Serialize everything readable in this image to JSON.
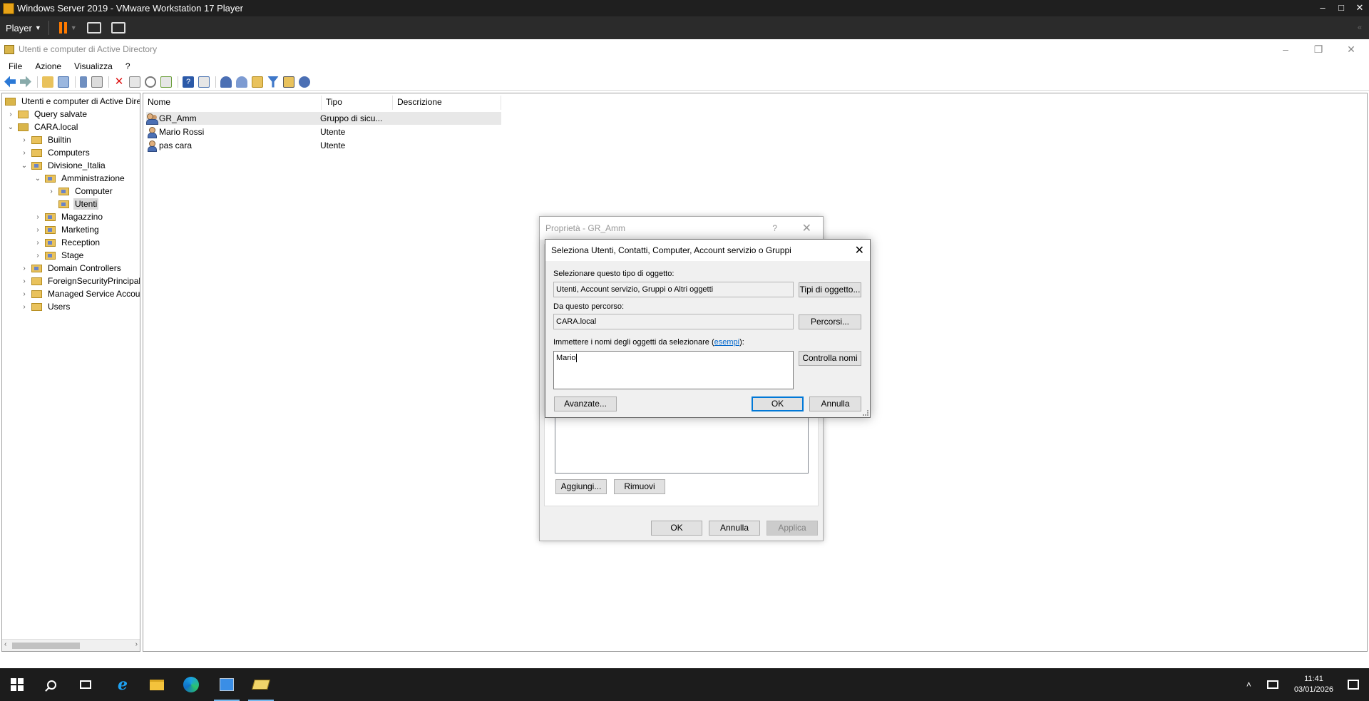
{
  "vmware": {
    "title": "Windows Server 2019 - VMware Workstation 17 Player",
    "player_menu": "Player",
    "window_buttons": {
      "minimize": "–",
      "maximize": "□",
      "close": "✕"
    },
    "collapse_glyph": "«"
  },
  "mmc": {
    "title": "Utenti e computer di Active Directory",
    "menu": [
      "File",
      "Azione",
      "Visualizza",
      "?"
    ],
    "window_buttons": {
      "minimize": "–",
      "restore": "❐",
      "close": "✕"
    }
  },
  "tree": [
    {
      "label": "Utenti e computer di Active Dire",
      "level": 0,
      "expander": "",
      "type": "root"
    },
    {
      "label": "Query salvate",
      "level": 1,
      "expander": ">",
      "type": "folder"
    },
    {
      "label": "CARA.local",
      "level": 1,
      "expander": "v",
      "type": "domain"
    },
    {
      "label": "Builtin",
      "level": 2,
      "expander": ">",
      "type": "folder"
    },
    {
      "label": "Computers",
      "level": 2,
      "expander": ">",
      "type": "folder"
    },
    {
      "label": "Divisione_Italia",
      "level": 2,
      "expander": "v",
      "type": "ou"
    },
    {
      "label": "Amministrazione",
      "level": 3,
      "expander": "v",
      "type": "ou"
    },
    {
      "label": "Computer",
      "level": 4,
      "expander": ">",
      "type": "ou"
    },
    {
      "label": "Utenti",
      "level": 4,
      "expander": "",
      "type": "ou",
      "selected": true
    },
    {
      "label": "Magazzino",
      "level": 3,
      "expander": ">",
      "type": "ou"
    },
    {
      "label": "Marketing",
      "level": 3,
      "expander": ">",
      "type": "ou"
    },
    {
      "label": "Reception",
      "level": 3,
      "expander": ">",
      "type": "ou"
    },
    {
      "label": "Stage",
      "level": 3,
      "expander": ">",
      "type": "ou"
    },
    {
      "label": "Domain Controllers",
      "level": 2,
      "expander": ">",
      "type": "ou"
    },
    {
      "label": "ForeignSecurityPrincipals",
      "level": 2,
      "expander": ">",
      "type": "folder"
    },
    {
      "label": "Managed Service Accour",
      "level": 2,
      "expander": ">",
      "type": "folder"
    },
    {
      "label": "Users",
      "level": 2,
      "expander": ">",
      "type": "folder"
    }
  ],
  "list": {
    "columns": [
      "Nome",
      "Tipo",
      "Descrizione"
    ],
    "rows": [
      {
        "name": "GR_Amm",
        "type": "Gruppo di sicu...",
        "icon": "group-icon",
        "selected": true
      },
      {
        "name": "Mario Rossi",
        "type": "Utente",
        "icon": "user-icon"
      },
      {
        "name": "pas cara",
        "type": "Utente",
        "icon": "user-icon"
      }
    ]
  },
  "properties_dialog": {
    "title": "Proprietà - GR_Amm",
    "help": "?",
    "close": "✕",
    "add_button": "Aggiungi...",
    "remove_button": "Rimuovi",
    "ok_button": "OK",
    "cancel_button": "Annulla",
    "apply_button": "Applica"
  },
  "select_dialog": {
    "title": "Seleziona Utenti, Contatti, Computer, Account servizio o Gruppi",
    "close": "✕",
    "object_type_label": "Selezionare questo tipo di oggetto:",
    "object_type_value": "Utenti, Account servizio, Gruppi o Altri oggetti",
    "object_types_button": "Tipi di oggetto...",
    "location_label": "Da questo percorso:",
    "location_value": "CARA.local",
    "locations_button": "Percorsi...",
    "names_label_prefix": "Immettere i nomi degli oggetti da selezionare (",
    "names_label_link": "esempi",
    "names_label_suffix": "):",
    "names_value": "Mario",
    "check_names_button": "Controlla nomi",
    "advanced_button": "Avanzate...",
    "ok_button": "OK",
    "cancel_button": "Annulla"
  },
  "taskbar": {
    "time": "11:41",
    "date": "03/01/2026",
    "tray_up": "˄"
  }
}
